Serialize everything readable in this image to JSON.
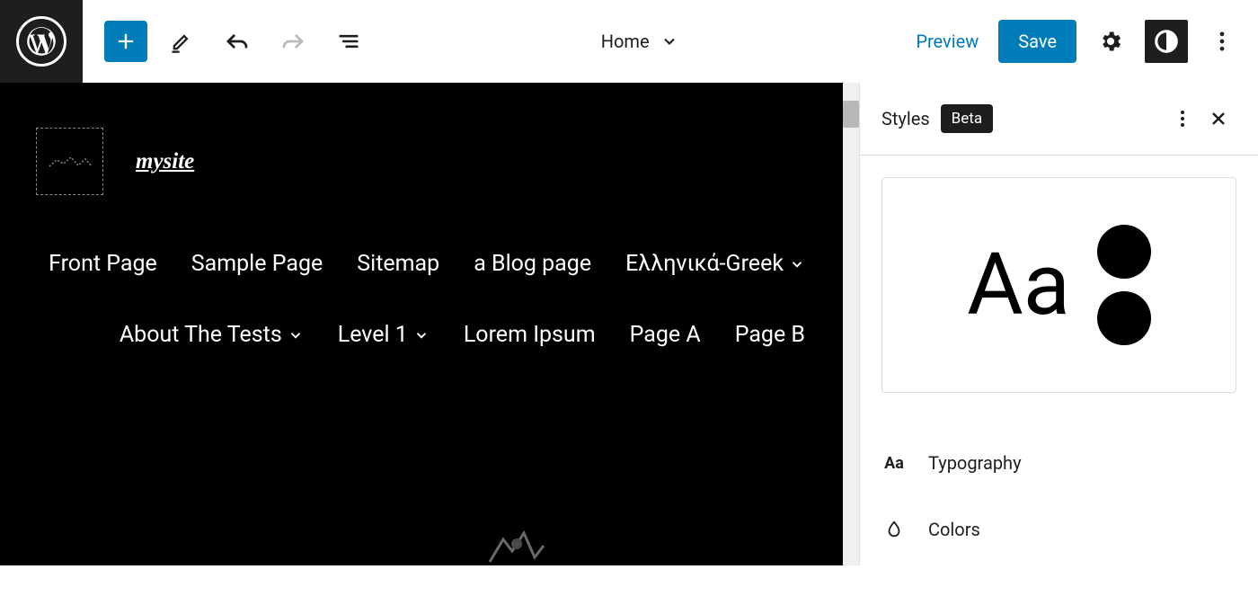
{
  "toolbar": {
    "document_title": "Home",
    "preview_label": "Preview",
    "save_label": "Save"
  },
  "canvas": {
    "site_title": "mysite",
    "nav_items": [
      {
        "label": "Front Page",
        "has_submenu": false
      },
      {
        "label": "Sample Page",
        "has_submenu": false
      },
      {
        "label": "Sitemap",
        "has_submenu": false
      },
      {
        "label": "a Blog page",
        "has_submenu": false
      },
      {
        "label": "Ελληνικά-Greek",
        "has_submenu": true
      },
      {
        "label": "About The Tests",
        "has_submenu": true
      },
      {
        "label": "Level 1",
        "has_submenu": true
      },
      {
        "label": "Lorem Ipsum",
        "has_submenu": false
      },
      {
        "label": "Page A",
        "has_submenu": false
      },
      {
        "label": "Page B",
        "has_submenu": false
      }
    ]
  },
  "sidebar": {
    "title": "Styles",
    "badge": "Beta",
    "preview_text": "Aa",
    "sections": [
      {
        "icon": "typography-icon",
        "label": "Typography"
      },
      {
        "icon": "colors-icon",
        "label": "Colors"
      }
    ]
  },
  "colors": {
    "accent": "#007cba",
    "dark": "#1e1e1e"
  }
}
